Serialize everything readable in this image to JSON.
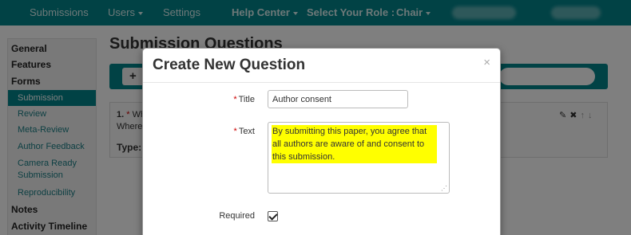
{
  "topnav": {
    "items": [
      {
        "label": "Submissions"
      },
      {
        "label": "Users"
      },
      {
        "label": "Settings"
      },
      {
        "label": "Help Center"
      },
      {
        "label": "Select Your Role :"
      },
      {
        "label": "Chair"
      }
    ]
  },
  "sidebar": {
    "items": [
      {
        "label": "General"
      },
      {
        "label": "Features"
      },
      {
        "label": "Forms"
      },
      {
        "label": "Submission"
      },
      {
        "label": "Review"
      },
      {
        "label": "Meta-Review"
      },
      {
        "label": "Author Feedback"
      },
      {
        "label": "Camera Ready Submission"
      },
      {
        "label": "Reproducibility"
      },
      {
        "label": "Notes"
      },
      {
        "label": "Activity Timeline"
      }
    ]
  },
  "page": {
    "title": "Submission Questions",
    "add_icon": "+",
    "question": {
      "number": "1.",
      "required_mark": "*",
      "line1_visible": "Wh",
      "line2_visible": "Where",
      "type_label": "Type:"
    },
    "actions": {
      "edit": "✎",
      "delete": "✖",
      "up": "↑",
      "down": "↓"
    }
  },
  "modal": {
    "title": "Create New Question",
    "close": "×",
    "fields": {
      "title_label": "Title",
      "title_value": "Author consent",
      "text_label": "Text",
      "text_value": "By submitting this paper, you agree that all authors are aware of and consent to this submission.",
      "required_label": "Required",
      "required_mark": "*"
    }
  },
  "colors": {
    "accent": "#02848b",
    "highlight": "#ffff00",
    "required": "#cc0000"
  }
}
